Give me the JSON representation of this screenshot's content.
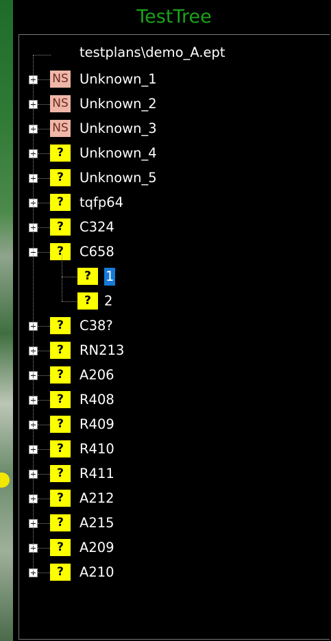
{
  "panel": {
    "title": "TestTree"
  },
  "tree": {
    "root": "testplans\\demo_A.ept",
    "items": [
      {
        "label": "Unknown_1",
        "badge": "NS"
      },
      {
        "label": "Unknown_2",
        "badge": "NS"
      },
      {
        "label": "Unknown_3",
        "badge": "NS"
      },
      {
        "label": "Unknown_4",
        "badge": "?"
      },
      {
        "label": "Unknown_5",
        "badge": "?"
      },
      {
        "label": "tqfp64",
        "badge": "?"
      },
      {
        "label": "C324",
        "badge": "?"
      },
      {
        "label": "C658",
        "badge": "?",
        "expanded": true,
        "children": [
          {
            "label": "1",
            "badge": "?",
            "selected": true
          },
          {
            "label": "2",
            "badge": "?"
          }
        ]
      },
      {
        "label": "C38?",
        "badge": "?"
      },
      {
        "label": "RN213",
        "badge": "?"
      },
      {
        "label": "A206",
        "badge": "?"
      },
      {
        "label": "R408",
        "badge": "?"
      },
      {
        "label": "R409",
        "badge": "?"
      },
      {
        "label": "R410",
        "badge": "?"
      },
      {
        "label": "R411",
        "badge": "?"
      },
      {
        "label": "A212",
        "badge": "?"
      },
      {
        "label": "A215",
        "badge": "?"
      },
      {
        "label": "A209",
        "badge": "?"
      },
      {
        "label": "A210",
        "badge": "?"
      }
    ]
  },
  "colors": {
    "title": "#19a319",
    "ns_badge": "#efb7a7",
    "unknown_badge": "#fbff00",
    "selection": "#1679d6"
  }
}
